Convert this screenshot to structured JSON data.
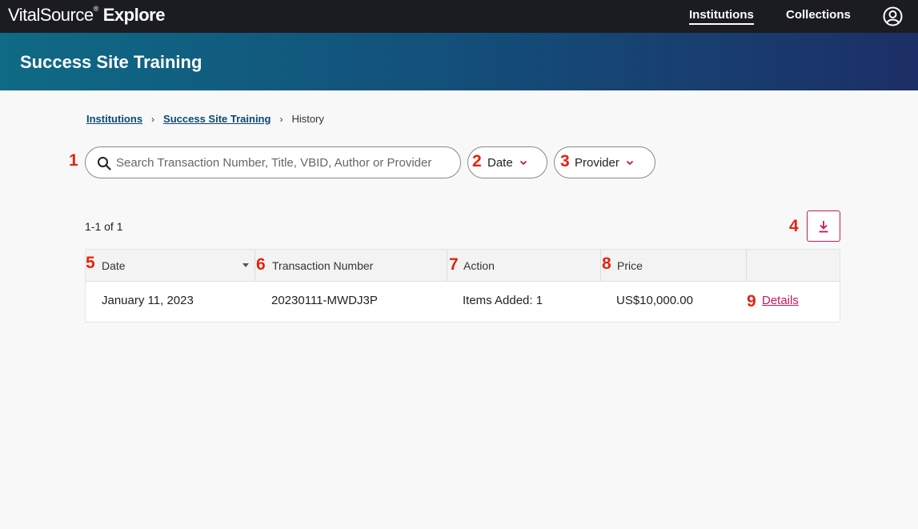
{
  "header": {
    "brand_vital": "VitalSource",
    "brand_reg": "®",
    "brand_explore": "Explore",
    "nav": [
      {
        "label": "Institutions",
        "active": true
      },
      {
        "label": "Collections",
        "active": false
      }
    ],
    "account_icon": "account-circle-icon"
  },
  "banner": {
    "title": "Success Site Training"
  },
  "breadcrumb": {
    "items": [
      {
        "label": "Institutions",
        "link": true
      },
      {
        "label": "Success Site Training",
        "link": true
      },
      {
        "label": "History",
        "link": false
      }
    ],
    "separator": "›"
  },
  "filters": {
    "search_placeholder": "Search Transaction Number, Title, VBID, Author or Provider",
    "search_value": "",
    "date_label": "Date",
    "provider_label": "Provider"
  },
  "results": {
    "count_text": "1-1 of 1",
    "download_icon": "download-icon"
  },
  "table": {
    "columns": [
      "Date",
      "Transaction Number",
      "Action",
      "Price",
      ""
    ],
    "rows": [
      {
        "date": "January 11, 2023",
        "transaction": "20230111-MWDJ3P",
        "action": "Items Added: 1",
        "price": "US$10,000.00",
        "link": "Details"
      }
    ]
  },
  "markers": [
    "1",
    "2",
    "3",
    "4",
    "5",
    "6",
    "7",
    "8",
    "9"
  ],
  "colors": {
    "topbar": "#1b1b22",
    "accent": "#c2185b",
    "link": "#0a4a72",
    "marker": "#e8200e"
  }
}
